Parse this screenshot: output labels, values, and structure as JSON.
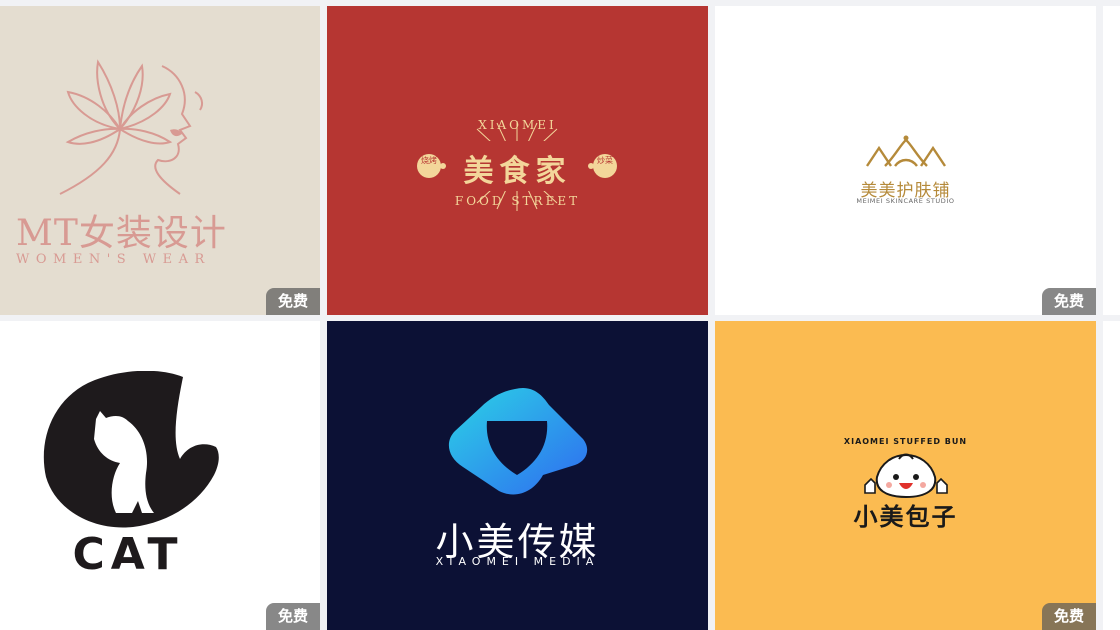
{
  "badge_label": "免费",
  "cards": [
    {
      "bg": "#e4ddd0",
      "title": "MT女装设计",
      "subtitle": "WOMEN'S WEAR",
      "free": true
    },
    {
      "bg": "#b63632",
      "top_arc": "XIAOMEI",
      "title": "美食家",
      "bottom_arc": "FOOD STREET",
      "left_seal": "烧烤",
      "right_seal": "炒菜",
      "free": false
    },
    {
      "bg": "#ffffff",
      "title": "美美护肤铺",
      "subtitle": "MEIMEI SKINCARE STUDIO",
      "free": true
    },
    {
      "bg": "#ffffff",
      "title": "CAT",
      "free": true
    },
    {
      "bg": "#0c1135",
      "title": "小美传媒",
      "subtitle": "XIAOMEI MEDIA",
      "free": false
    },
    {
      "bg": "#fbbb51",
      "arc": "XIAOMEI STUFFED BUN",
      "title": "小美包子",
      "free": true
    }
  ],
  "icons": [
    "lotus-face-logo",
    "food-sunburst-logo",
    "crown-logo",
    "cat-moon-logo",
    "triangle-shield-logo",
    "bun-mascot-logo"
  ]
}
